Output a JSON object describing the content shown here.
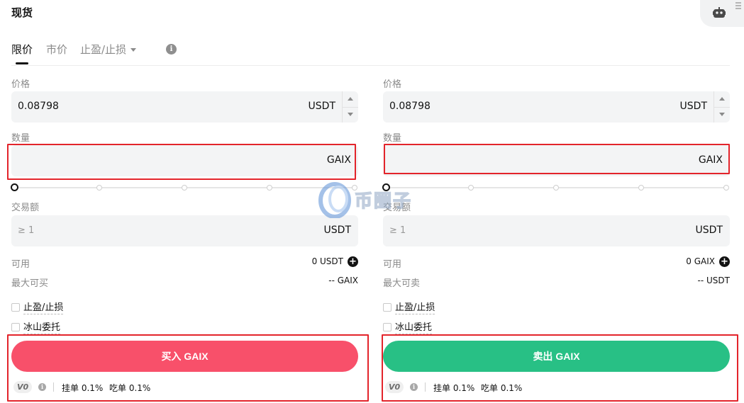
{
  "header": {
    "title": "现货"
  },
  "tabs": [
    {
      "label": "限价",
      "active": true
    },
    {
      "label": "市价",
      "active": false
    },
    {
      "label": "止盈/止损",
      "active": false
    }
  ],
  "buy": {
    "price_label": "价格",
    "price_value": "0.08798",
    "price_unit": "USDT",
    "qty_label": "数量",
    "qty_unit": "GAIX",
    "amount_label": "交易额",
    "amount_placeholder": "≥ 1",
    "amount_unit": "USDT",
    "available_label": "可用",
    "available_value": "0 USDT",
    "max_label": "最大可买",
    "max_value": "-- GAIX",
    "tpsl_label": "止盈/止损",
    "iceberg_label": "冰山委托",
    "button_label": "买入 GAIX",
    "vip_label": "V0",
    "maker_fee": "挂单 0.1%",
    "taker_fee": "吃单 0.1%",
    "slider_percent": 0
  },
  "sell": {
    "price_label": "价格",
    "price_value": "0.08798",
    "price_unit": "USDT",
    "qty_label": "数量",
    "qty_unit": "GAIX",
    "amount_label": "交易额",
    "amount_placeholder": "≥ 1",
    "amount_unit": "USDT",
    "available_label": "可用",
    "available_value": "0 GAIX",
    "max_label": "最大可卖",
    "max_value": "-- USDT",
    "tpsl_label": "止盈/止损",
    "iceberg_label": "冰山委托",
    "button_label": "卖出 GAIX",
    "vip_label": "V0",
    "maker_fee": "挂单 0.1%",
    "taker_fee": "吃单 0.1%",
    "slider_percent": 0
  },
  "watermark": {
    "text": "币圈子"
  },
  "colors": {
    "buy": "#f8506a",
    "sell": "#28c085",
    "highlight": "#e3242b"
  },
  "icons": {
    "robot": "robot-icon",
    "info": "info-icon",
    "plus": "plus-circle-icon",
    "dropdown": "caret-down-icon"
  }
}
